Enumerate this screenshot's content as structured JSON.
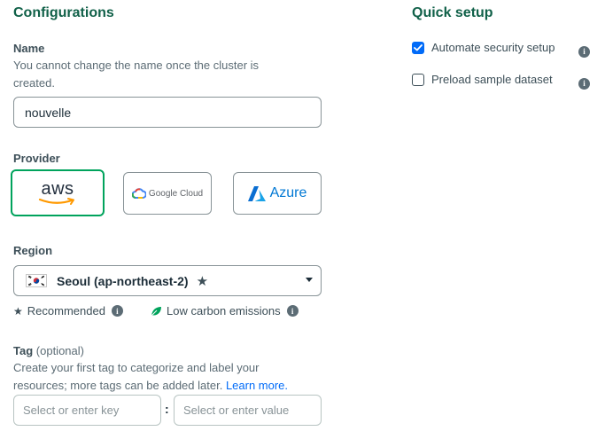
{
  "configurations": {
    "title": "Configurations",
    "name": {
      "label": "Name",
      "description": "You cannot change the name once the cluster is created.",
      "value": "nouvelle"
    },
    "provider": {
      "label": "Provider",
      "options": [
        {
          "label": "aws",
          "selected": true
        },
        {
          "label": "Google Cloud",
          "selected": false
        },
        {
          "label": "Azure",
          "selected": false
        }
      ]
    },
    "region": {
      "label": "Region",
      "selected": "Seoul (ap-northeast-2)",
      "legend_recommended": "Recommended",
      "legend_low_carbon": "Low carbon emissions"
    },
    "tag": {
      "label": "Tag",
      "optional": "(optional)",
      "description": "Create your first tag to categorize and label your resources; more tags can be added later.",
      "link": "Learn more.",
      "key_placeholder": "Select or enter key",
      "value_placeholder": "Select or enter value",
      "separator": ":"
    }
  },
  "quick_setup": {
    "title": "Quick setup",
    "options": [
      {
        "label": "Automate security setup",
        "checked": true
      },
      {
        "label": "Preload sample dataset",
        "checked": false
      }
    ]
  },
  "colors": {
    "heading": "#116149",
    "selected_border": "#00a35c",
    "checkbox_checked": "#016bf8",
    "link": "#016bf8"
  },
  "icons": [
    "aws-logo",
    "google-cloud-logo",
    "azure-logo",
    "korea-flag-icon",
    "star-icon",
    "leaf-icon",
    "info-icon",
    "chevron-down-icon",
    "check-icon"
  ]
}
